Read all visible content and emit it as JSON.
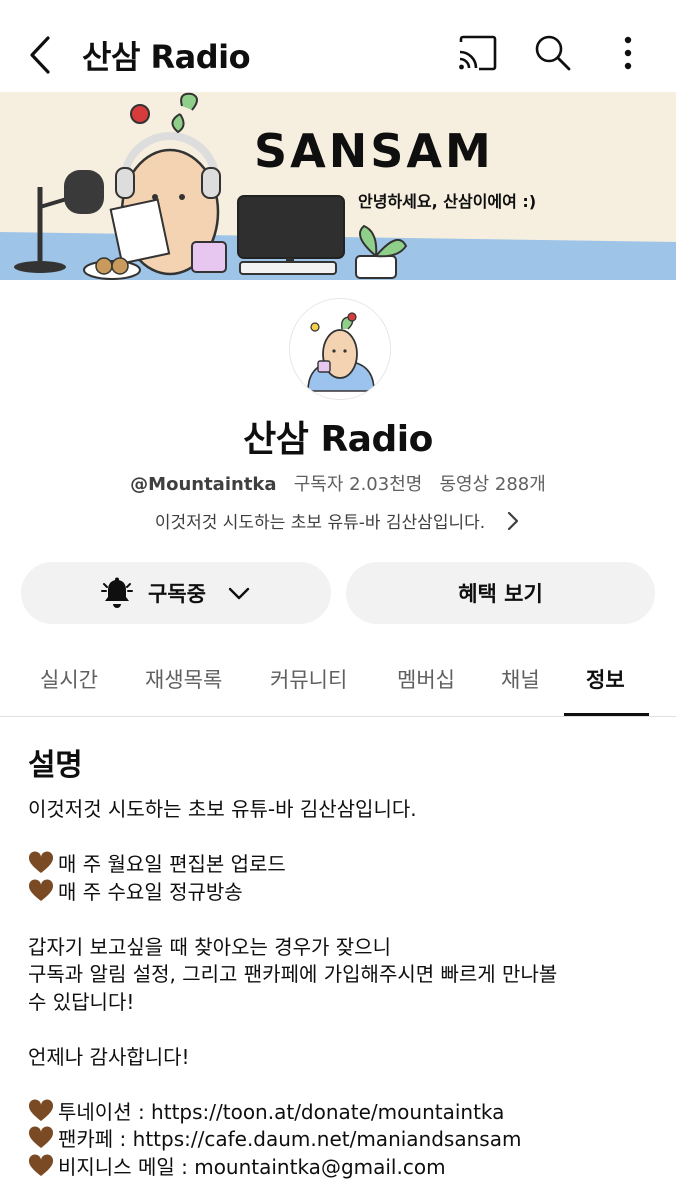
{
  "header": {
    "title": "산삼 Radio",
    "icons": [
      "back-icon",
      "cast-icon",
      "search-icon",
      "more-vert-icon"
    ]
  },
  "banner": {
    "brand": "SANSAM",
    "greeting": "안녕하세요, 산삼이에여 :)"
  },
  "channel": {
    "name": "산삼 Radio",
    "handle": "@Mountaintka",
    "subscribers": "구독자 2.03천명",
    "videos": "동영상 288개",
    "short_description": "이것저것 시도하는 초보 유튜-바 김산삼입니다."
  },
  "actions": {
    "subscribe_label": "구독중",
    "benefit_label": "혜택 보기"
  },
  "tabs": [
    {
      "label": "실시간"
    },
    {
      "label": "재생목록"
    },
    {
      "label": "커뮤니티"
    },
    {
      "label": "멤버십"
    },
    {
      "label": "채널"
    },
    {
      "label": "정보",
      "active": true
    }
  ],
  "about": {
    "heading": "설명",
    "line1": "이것저것 시도하는 초보 유튜-바 김산삼입니다.",
    "schedule1": "매 주 월요일 편집본 업로드",
    "schedule2": "매 주 수요일 정규방송",
    "para2_line1": "갑자기 보고싶을 때 찾아오는 경우가 잦으니",
    "para2_line2": "구독과 알림 설정, 그리고 팬카페에 가입해주시면 빠르게 만나볼",
    "para2_line3": "수 있답니다!",
    "thanks": "언제나 감사합니다!",
    "link1": "투네이션 :  https://toon.at/donate/mountaintka",
    "link2": "팬카페 : https://cafe.daum.net/maniandsansam",
    "link3": "비지니스 메일 : mountaintka@gmail.com"
  },
  "colors": {
    "heart": "#7a4a24",
    "banner_bg": "#f6efdf",
    "desk_blue": "#9ec4e8"
  }
}
